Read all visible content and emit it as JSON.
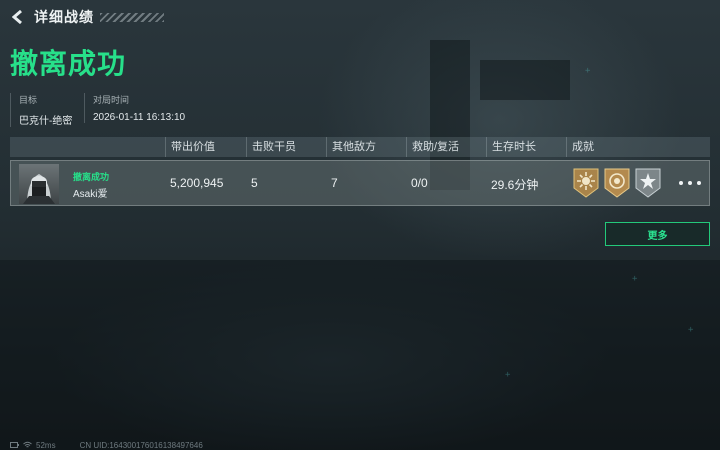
{
  "header": {
    "title": "详细战绩",
    "back_icon": "chevron-left-icon"
  },
  "result": {
    "title": "撤离成功",
    "color": "#27e08a"
  },
  "meta": [
    {
      "label": "目标",
      "value": "巴克什-绝密"
    },
    {
      "label": "对局时间",
      "value": "2026-01-11 16:13:10"
    }
  ],
  "table": {
    "columns": [
      "带出价值",
      "击败干员",
      "其他敌方",
      "救助/复活",
      "生存时长",
      "成就"
    ],
    "rows": [
      {
        "status": "撤离成功",
        "player": "Asaki爱",
        "value": "5,200,945",
        "kills": "5",
        "other_enemies": "7",
        "assist_revive": "0/0",
        "survival_time": "29.6分钟",
        "achievements": [
          "sun-medal-icon",
          "target-medal-icon",
          "star-medal-icon"
        ],
        "more_icon": "more-dots-icon"
      }
    ]
  },
  "more_button": {
    "label": "更多",
    "color": "#2be391"
  },
  "footer": {
    "ping": "52ms",
    "uid": "CN UID:164300176016138497646"
  }
}
